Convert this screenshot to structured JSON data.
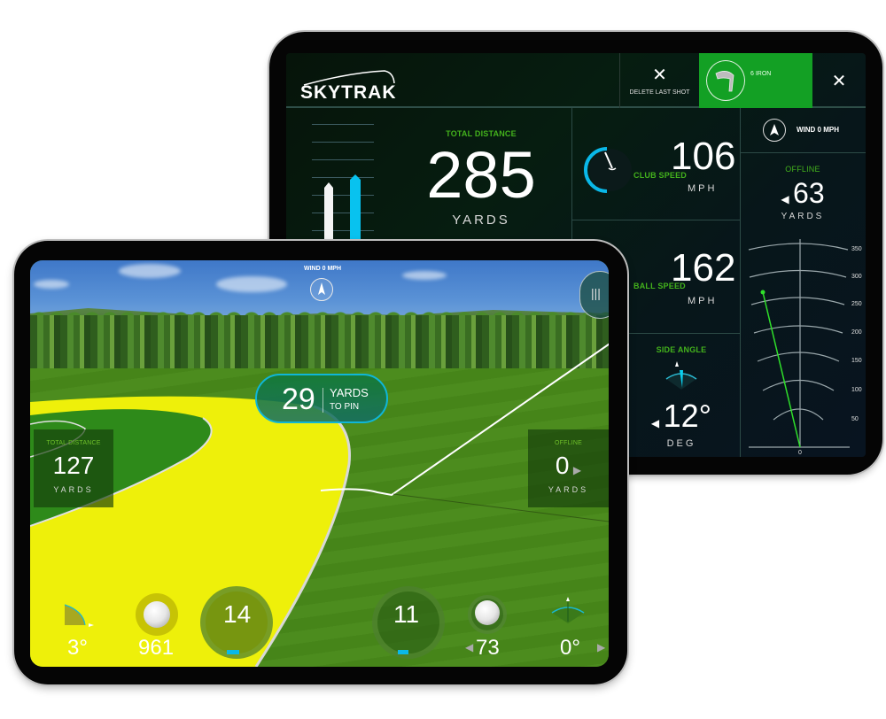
{
  "back_tablet": {
    "logo": "SKYTRAK",
    "toolbar": {
      "delete_icon": "close-icon",
      "delete_label": "DELETE LAST SHOT",
      "club_label": "6 IRON",
      "club_icon": "iron-club-icon",
      "close_icon": "close-icon"
    },
    "total_distance": {
      "label": "TOTAL DISTANCE",
      "value": "285",
      "unit": "YARDS"
    },
    "club_speed": {
      "label": "CLUB SPEED",
      "value": "106",
      "unit": "MPH"
    },
    "ball_speed": {
      "label": "BALL SPEED",
      "value": "162",
      "unit": "MPH"
    },
    "side_angle": {
      "label": "SIDE ANGLE",
      "value": "12°",
      "unit": "DEG",
      "direction": "left"
    },
    "wind": {
      "label": "WIND 0 MPH"
    },
    "offline": {
      "label": "OFFLINE",
      "value": "63",
      "unit": "YARDS",
      "direction": "left"
    },
    "trajectory_scale": [
      "350",
      "300",
      "250",
      "200",
      "150",
      "100",
      "50",
      "0"
    ]
  },
  "front_tablet": {
    "wind": {
      "label": "WIND 0 MPH"
    },
    "to_pin": {
      "value": "29",
      "line1": "YARDS",
      "line2": "TO PIN"
    },
    "total_distance": {
      "label": "TOTAL DISTANCE",
      "value": "127",
      "unit": "YARDS"
    },
    "offline": {
      "label": "OFFLINE",
      "value": "0",
      "unit": "YARDS"
    },
    "side_tab_icon": "menu-handle-icon",
    "bottom_stats": {
      "launch_angle": "3°",
      "backspin": "961",
      "club_speed_gauge": "14",
      "ball_speed_gauge": "11",
      "sidespin": "73",
      "side_angle": "0°"
    }
  }
}
